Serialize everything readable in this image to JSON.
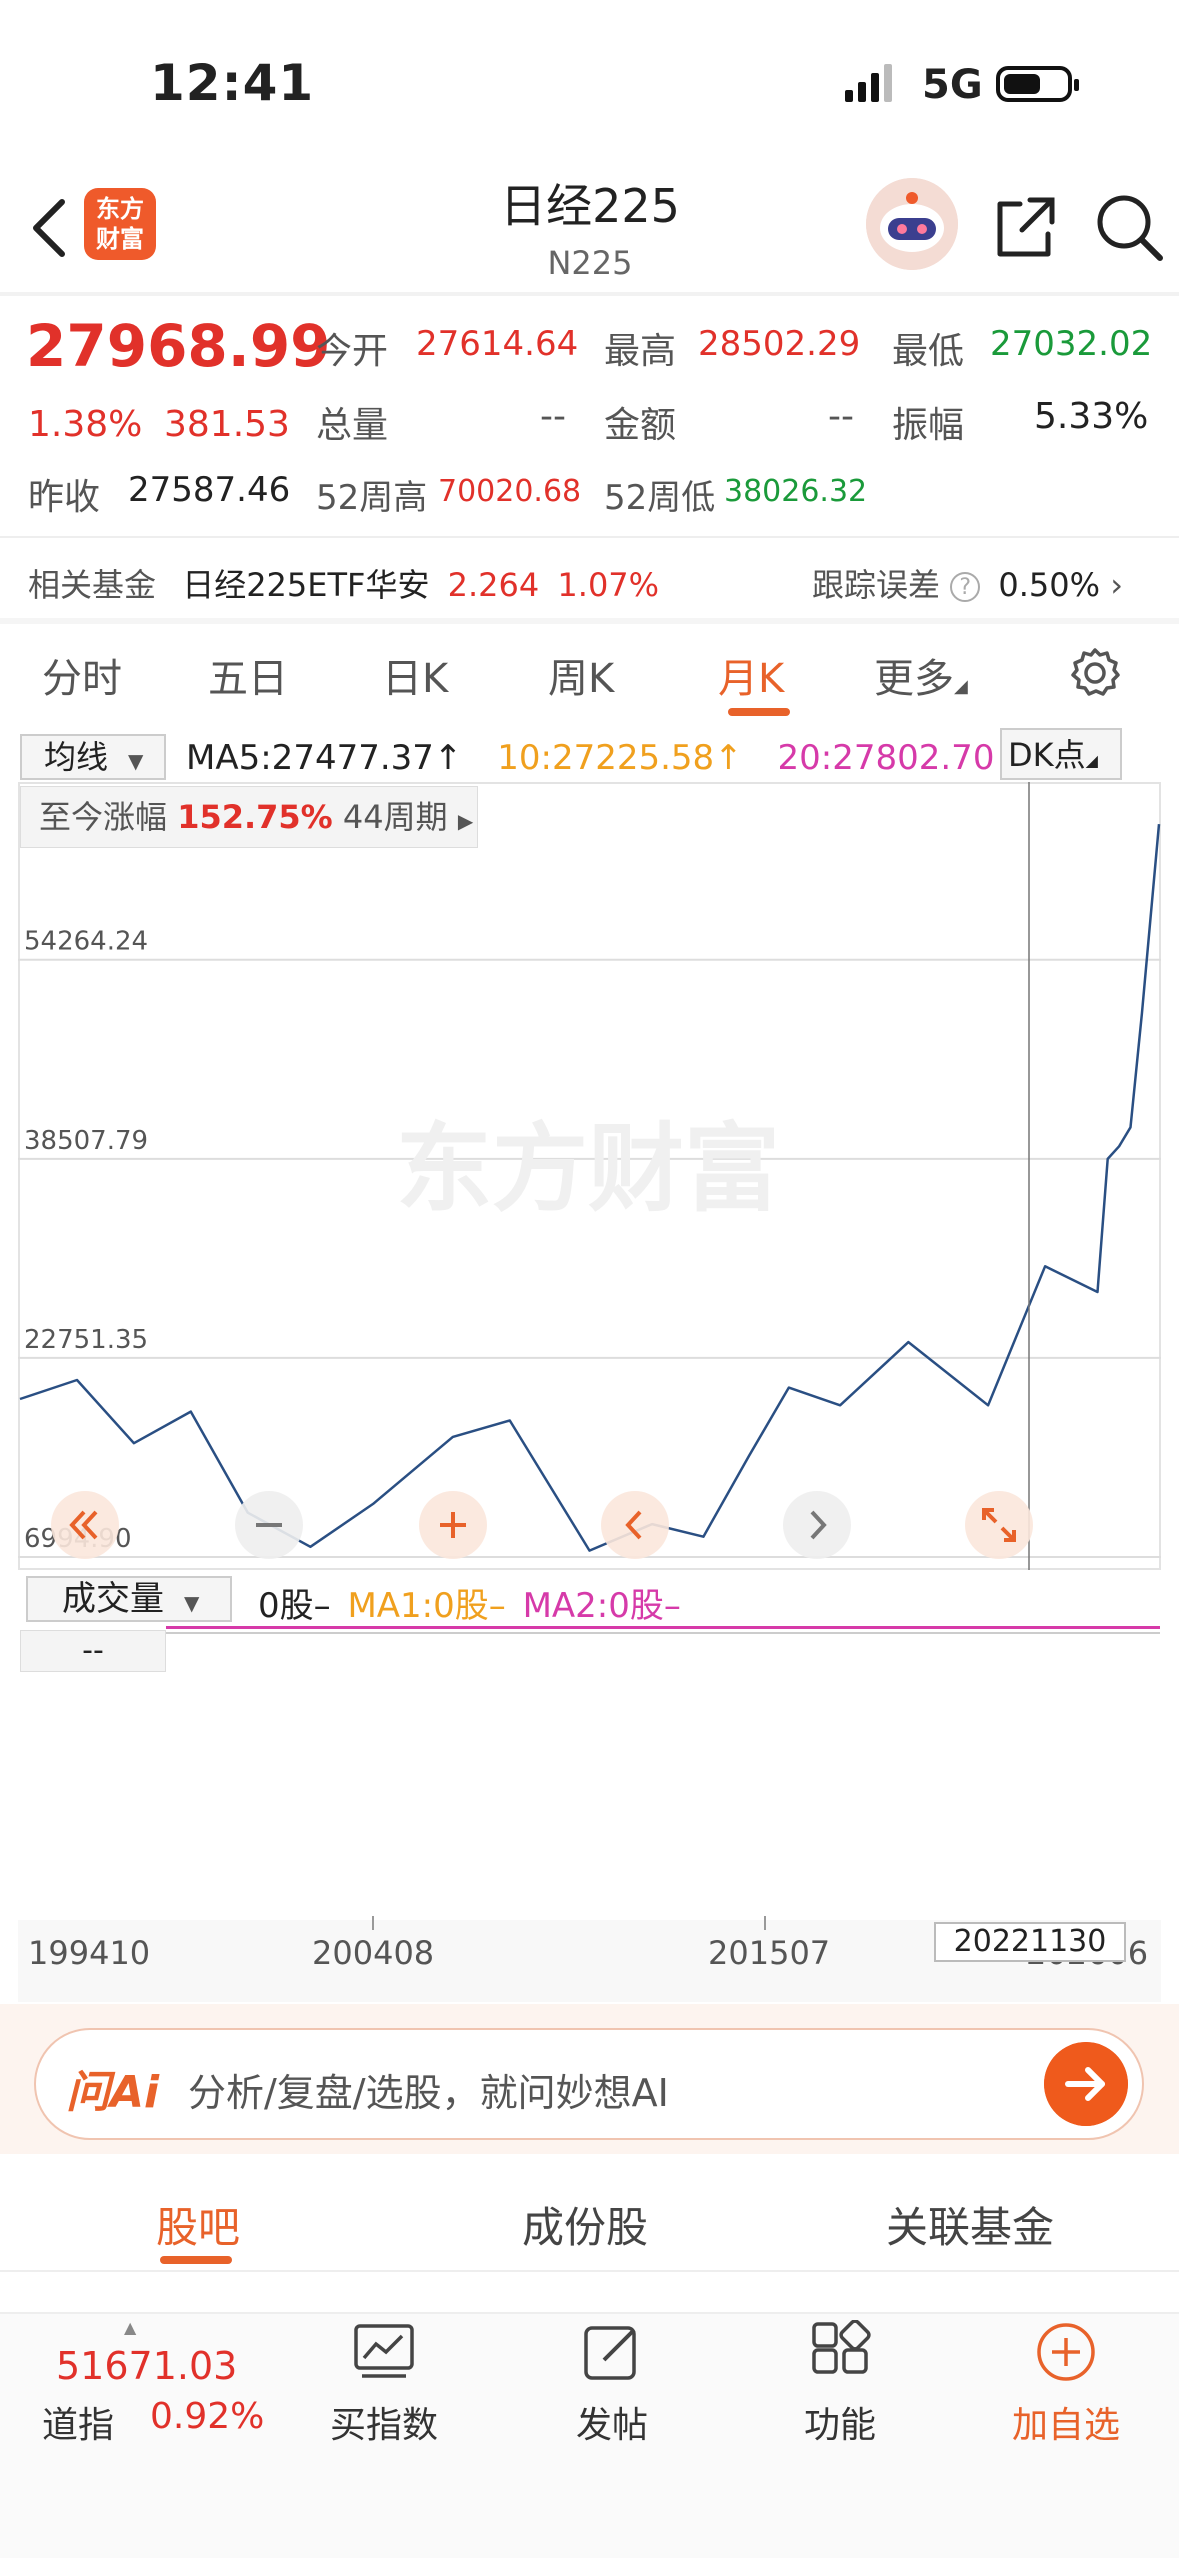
{
  "status": {
    "time": "12:41",
    "network": "5G"
  },
  "header": {
    "logo_text": "东方\n财富",
    "title": "日经225",
    "code": "N225"
  },
  "quote": {
    "price": "27968.99",
    "change_pct": "1.38%",
    "change": "381.53",
    "open_label": "今开",
    "open": "27614.64",
    "high_label": "最高",
    "high": "28502.29",
    "low_label": "最低",
    "low": "27032.02",
    "volume_label": "总量",
    "volume": "--",
    "amount_label": "金额",
    "amount": "--",
    "amplitude_label": "振幅",
    "amplitude": "5.33%",
    "prev_close_label": "昨收",
    "prev_close": "27587.46",
    "w52_high_label": "52周高",
    "w52_high": "70020.68",
    "w52_low_label": "52周低",
    "w52_low": "38026.32"
  },
  "fund": {
    "label": "相关基金",
    "name": "日经225ETF华安",
    "price": "2.264",
    "pct": "1.07%",
    "tracking_label": "跟踪误差",
    "tracking_value": "0.50%"
  },
  "period_tabs": [
    "分时",
    "五日",
    "日K",
    "周K",
    "月K",
    "更多"
  ],
  "active_period": "月K",
  "chart": {
    "ma_select": "均线",
    "ma5": "MA5:27477.37",
    "ma10": "10:27225.58",
    "ma20": "20:27802.70",
    "dk_label": "DK点",
    "gain_label": "至今涨幅",
    "gain_value": "152.75%",
    "gain_period": "44周期",
    "y_labels": [
      "54264.24",
      "38507.79",
      "22751.35",
      "6994.90"
    ],
    "watermark": "东方财富",
    "volume_select": "成交量",
    "vol_value": "0股–",
    "vol_ma1": "MA1:0股–",
    "vol_ma2": "MA2:0股–",
    "vol_box": "--",
    "x_labels": [
      "199410",
      "200408",
      "201507",
      "202606"
    ],
    "crosshair_date": "20221130",
    "colors": {
      "line": "#2a4f83",
      "ma10": "#f0a01e",
      "ma20": "#d63aa9",
      "up": "#e1312a",
      "down": "#1a9a3a"
    }
  },
  "chart_data": {
    "type": "line",
    "x": [
      "199410",
      "199601",
      "199801",
      "200001",
      "200201",
      "200306",
      "200408",
      "200601",
      "200707",
      "200903",
      "201007",
      "201207",
      "201403",
      "201507",
      "201701",
      "201809",
      "202003",
      "202106",
      "202211",
      "202402",
      "202406",
      "202507",
      "202512",
      "202606"
    ],
    "values": [
      19500,
      21000,
      16000,
      18500,
      10500,
      7800,
      11200,
      16500,
      17800,
      7500,
      9600,
      8600,
      15000,
      20400,
      19000,
      24000,
      19000,
      30000,
      27969,
      38500,
      39500,
      41000,
      50000,
      65000
    ],
    "ylim": [
      6994.9,
      62000
    ],
    "y_ticks": [
      6994.9,
      22751.35,
      38507.79,
      54264.24
    ]
  },
  "ai": {
    "logo": "问Ai",
    "placeholder": "分析/复盘/选股，就问妙想AI"
  },
  "bottom_tabs": [
    "股吧",
    "成份股",
    "关联基金"
  ],
  "bottom_bar": {
    "dow_value": "51671.03",
    "dow_label": "道指",
    "dow_pct": "0.92%",
    "items": [
      "买指数",
      "发帖",
      "功能",
      "加自选"
    ]
  }
}
